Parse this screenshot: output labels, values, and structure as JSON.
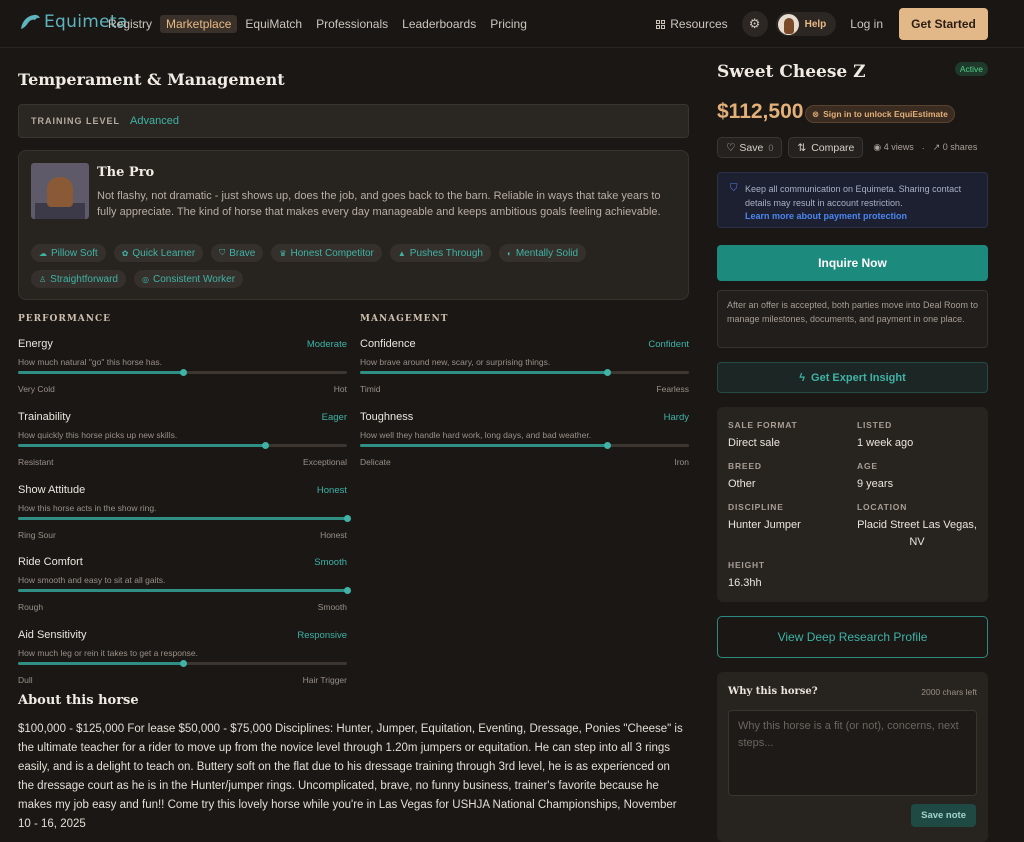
{
  "nav": {
    "logo": "Equimeta",
    "links": [
      "Registry",
      "Marketplace",
      "EquiMatch",
      "Professionals",
      "Leaderboards",
      "Pricing"
    ],
    "resources": "Resources",
    "help": "Help",
    "login": "Log in",
    "get_started": "Get Started"
  },
  "temperament": {
    "title": "Temperament & Management",
    "training_label": "TRAINING LEVEL",
    "training_value": "Advanced",
    "pro_title": "The Pro",
    "pro_desc": "Not flashy, not dramatic - just shows up, does the job, and goes back to the barn. Reliable in ways that take years to fully appreciate. The kind of horse that makes every day manageable and keeps ambitious goals feeling achievable.",
    "tags": [
      {
        "icon": "cloud-icon",
        "glyph": "☁",
        "label": "Pillow Soft"
      },
      {
        "icon": "brain-icon",
        "glyph": "✿",
        "label": "Quick Learner"
      },
      {
        "icon": "shield-icon",
        "glyph": "⛉",
        "label": "Brave"
      },
      {
        "icon": "trophy-icon",
        "glyph": "♛",
        "label": "Honest Competitor"
      },
      {
        "icon": "mountain-icon",
        "glyph": "▲",
        "label": "Pushes Through"
      },
      {
        "icon": "half-circle-icon",
        "glyph": "◐",
        "label": "Mentally Solid"
      },
      {
        "icon": "person-icon",
        "glyph": "♙",
        "label": "Straightforward"
      },
      {
        "icon": "target-icon",
        "glyph": "◎",
        "label": "Consistent Worker"
      }
    ]
  },
  "performance": {
    "heading": "PERFORMANCE",
    "metrics": [
      {
        "name": "Energy",
        "value": "Moderate",
        "desc": "How much natural \"go\" this horse has.",
        "low": "Very Cold",
        "high": "Hot",
        "level": 0.5
      },
      {
        "name": "Trainability",
        "value": "Eager",
        "desc": "How quickly this horse picks up new skills.",
        "low": "Resistant",
        "high": "Exceptional",
        "level": 0.75
      },
      {
        "name": "Show Attitude",
        "value": "Honest",
        "desc": "How this horse acts in the show ring.",
        "low": "Ring Sour",
        "high": "Honest",
        "level": 1.0
      },
      {
        "name": "Ride Comfort",
        "value": "Smooth",
        "desc": "How smooth and easy to sit at all gaits.",
        "low": "Rough",
        "high": "Smooth",
        "level": 1.0
      },
      {
        "name": "Aid Sensitivity",
        "value": "Responsive",
        "desc": "How much leg or rein it takes to get a response.",
        "low": "Dull",
        "high": "Hair Trigger",
        "level": 0.5
      }
    ]
  },
  "management": {
    "heading": "MANAGEMENT",
    "metrics": [
      {
        "name": "Confidence",
        "value": "Confident",
        "desc": "How brave around new, scary, or surprising things.",
        "low": "Timid",
        "high": "Fearless",
        "level": 0.75
      },
      {
        "name": "Toughness",
        "value": "Hardy",
        "desc": "How well they handle hard work, long days, and bad weather.",
        "low": "Delicate",
        "high": "Iron",
        "level": 0.75
      }
    ]
  },
  "about": {
    "title": "About this horse",
    "text": "$100,000 - $125,000 For lease $50,000 - $75,000 Disciplines: Hunter, Jumper, Equitation, Eventing, Dressage, Ponies \"Cheese\" is the ultimate teacher for a rider to move up from the novice level through 1.20m jumpers or equitation. He can step into all 3 rings easily, and is a delight to teach on. Buttery soft on the flat due to his dressage training through 3rd level, he is as experienced on the dressage court as he is in the Hunter/jumper rings. Uncomplicated, brave, no funny business, trainer's favorite because he makes my job easy and fun!! Come try this lovely horse while you're in Las Vegas for USHJA National Championships, November 10 - 16, 2025"
  },
  "listing": {
    "name": "Sweet Cheese Z",
    "status": "Active",
    "price": "$112,500",
    "unlock": "Sign in to unlock EquiEstimate",
    "save_label": "Save",
    "save_count": "0",
    "compare_label": "Compare",
    "views": "4 views",
    "shares": "0 shares",
    "notice_text": "Keep all communication on Equimeta. Sharing contact details may result in account restriction.",
    "notice_link": "Learn more about payment protection",
    "inquire": "Inquire Now",
    "deal_note": "After an offer is accepted, both parties move into Deal Room to manage milestones, documents, and payment in one place.",
    "expert": "Get Expert Insight",
    "details": {
      "sale_format_label": "SALE FORMAT",
      "sale_format": "Direct sale",
      "listed_label": "LISTED",
      "listed": "1 week ago",
      "breed_label": "BREED",
      "breed": "Other",
      "age_label": "AGE",
      "age": "9 years",
      "discipline_label": "DISCIPLINE",
      "discipline": "Hunter Jumper",
      "location_label": "LOCATION",
      "location": "Placid Street Las Vegas, NV",
      "height_label": "HEIGHT",
      "height": "16.3hh"
    },
    "deep_research": "View Deep Research Profile",
    "why_title": "Why this horse?",
    "why_count": "2000 chars left",
    "why_placeholder": "Why this horse is a fit (or not), concerns, next steps...",
    "why_save": "Save note"
  },
  "colors": {
    "accent": "#1d8a7e",
    "teal_text": "#3fb3a6",
    "gold": "#e3b07a",
    "background": "#1a1715"
  }
}
